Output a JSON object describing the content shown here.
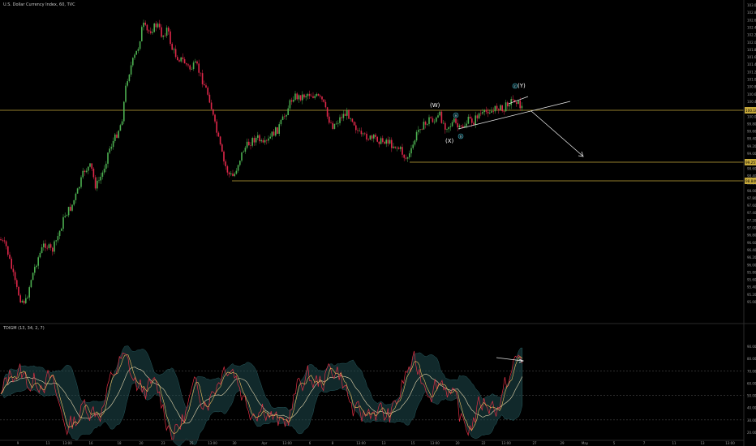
{
  "header": {
    "symbol_title": "U.S. Dollar Currency Index, 60, TVC",
    "indicator_title": "TDIGM (13, 34, 2, 7)"
  },
  "chart_data": {
    "type": "candlestick",
    "instrument": "U.S. Dollar Currency Index, 60, TVC",
    "price_axis": {
      "ticks": [
        "103.00",
        "102.80",
        "102.60",
        "102.40",
        "102.20",
        "102.00",
        "101.80",
        "101.60",
        "101.40",
        "101.20",
        "101.00",
        "100.80",
        "100.60",
        "100.40",
        "100.20",
        "100.00",
        "99.80",
        "99.60",
        "99.40",
        "99.20",
        "99.00",
        "98.80",
        "98.60",
        "98.40",
        "98.20",
        "98.00",
        "97.80",
        "97.60",
        "97.40",
        "97.20",
        "97.00",
        "96.80",
        "96.60",
        "96.40",
        "96.20",
        "96.00",
        "95.80",
        "95.60",
        "95.40",
        "95.20",
        "95.00"
      ],
      "labels": [
        {
          "text": "100.103",
          "color": "#c7a93b"
        },
        {
          "text": "99.257",
          "color": "#c7a93b"
        },
        {
          "text": "98.849",
          "color": "#c7a93b"
        }
      ]
    },
    "indicator_axis": {
      "ticks": [
        "90.00",
        "80.00",
        "70.00",
        "60.00",
        "50.00",
        "40.00",
        "30.00",
        "20.00"
      ]
    },
    "time_axis": {
      "ticks": [
        "9",
        "11",
        "13:00",
        "16",
        "18",
        "20",
        "23",
        "25",
        "13:00",
        "30",
        "Apr",
        "13:00",
        "6",
        "8",
        "13:00",
        "13",
        "15",
        "13:00",
        "20",
        "22",
        "13:00",
        "27",
        "29",
        "May",
        "5",
        "7",
        "11",
        "13",
        "13:00"
      ]
    },
    "wave_labels": [
      "(W)",
      "(X)",
      "(Y)",
      "a",
      "b",
      "c"
    ],
    "horizontal_levels": [
      100.103,
      99.257,
      98.849
    ],
    "colors": {
      "up": "#4caf50",
      "down": "#e0274a",
      "level": "#c7a93b",
      "indicator_price": "#e03045",
      "indicator_signal": "#f0c060",
      "indicator_band": "#1f4a4e",
      "indicator_mid": "#e8d9b0"
    }
  }
}
